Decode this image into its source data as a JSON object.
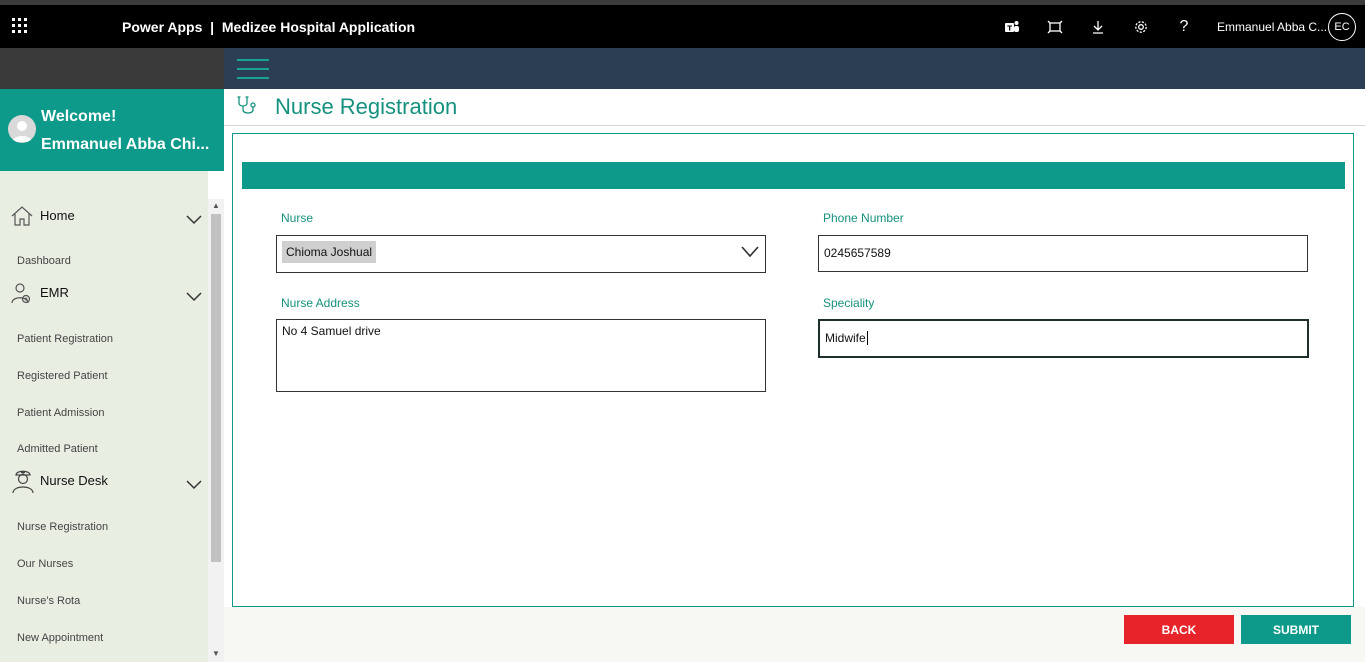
{
  "topbar": {
    "app_name": "Power Apps",
    "separator": "|",
    "app_title": "Medizee Hospital Application",
    "icons": [
      "teams-icon",
      "fit-screen-icon",
      "download-icon",
      "settings-icon",
      "help-icon"
    ],
    "help_glyph": "?",
    "user_name": "Emmanuel Abba C...",
    "user_initials": "EC"
  },
  "welcome": {
    "title": "Welcome!",
    "name": "Emmanuel Abba Chi..."
  },
  "sidebar": {
    "sections": [
      {
        "label": "Home",
        "items": [
          "Dashboard"
        ]
      },
      {
        "label": "EMR",
        "items": [
          "Patient Registration",
          "Registered Patient",
          "Patient Admission",
          "Admitted Patient"
        ]
      },
      {
        "label": "Nurse Desk",
        "items": [
          "Nurse Registration",
          "Our Nurses",
          "Nurse's Rota",
          "New Appointment"
        ]
      }
    ]
  },
  "page": {
    "title": "Nurse Registration"
  },
  "form": {
    "nurse": {
      "label": "Nurse",
      "value": "Chioma Joshual"
    },
    "phone": {
      "label": "Phone Number",
      "value": "0245657589"
    },
    "address": {
      "label": "Nurse Address",
      "value": "No 4 Samuel drive"
    },
    "speciality": {
      "label": "Speciality",
      "value": "Midwife"
    }
  },
  "buttons": {
    "back": "BACK",
    "submit": "SUBMIT"
  },
  "colors": {
    "accent": "#0e9a8a",
    "header": "#2c3e54",
    "danger": "#e8242b",
    "sidebar_bg": "#e9eee3"
  }
}
